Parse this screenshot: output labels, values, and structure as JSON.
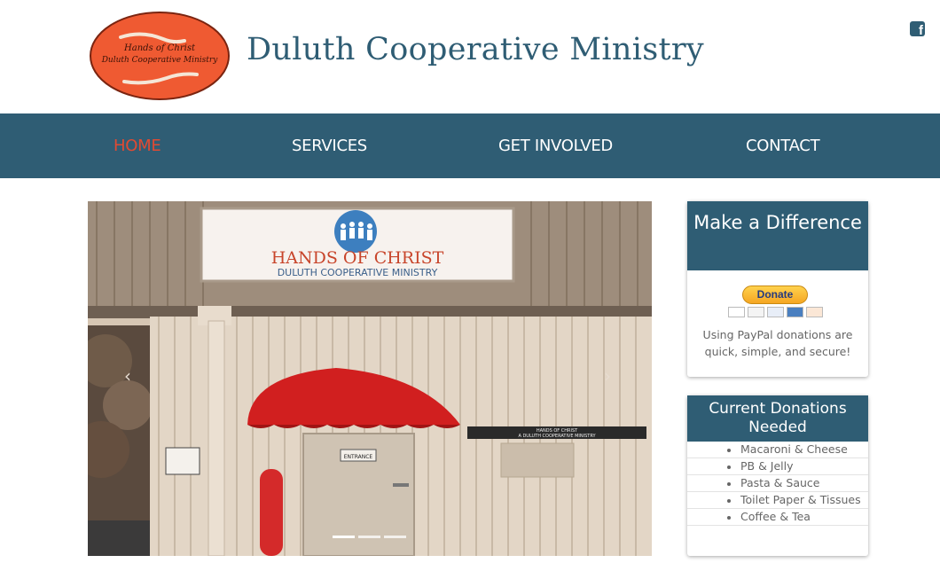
{
  "header": {
    "site_title": "Duluth Cooperative Ministry",
    "logo": {
      "line1": "Hands of Christ",
      "line2": "Duluth Cooperative Ministry"
    },
    "facebook_icon": "facebook-icon"
  },
  "nav": {
    "items": [
      {
        "label": "HOME",
        "active": true
      },
      {
        "label": "SERVICES",
        "active": false
      },
      {
        "label": "GET INVOLVED",
        "active": false
      },
      {
        "label": "CONTACT",
        "active": false
      }
    ]
  },
  "slider": {
    "sign_title": "HANDS OF CHRIST",
    "sign_subtitle": "DULUTH COOPERATIVE MINISTRY",
    "small_sign_line1": "HANDS OF CHRIST",
    "small_sign_line2": "A DULUTH COOPERATIVE MINISTRY",
    "door_sign": "ENTRANCE",
    "prev_icon": "chevron-left-icon",
    "next_icon": "chevron-right-icon",
    "prev_glyph": "‹",
    "next_glyph": "›",
    "slide_count": 3,
    "active_slide": 1
  },
  "donate_panel": {
    "title": "Make a Difference",
    "button_label": "Donate",
    "text": "Using PayPal donations are quick, simple, and secure!"
  },
  "donations_panel": {
    "title": "Current Donations Needed",
    "items": [
      "Macaroni & Cheese",
      "PB & Jelly",
      "Pasta & Sauce",
      "Toilet Paper & Tissues",
      "Coffee & Tea"
    ]
  },
  "colors": {
    "brand": "#2f5d74",
    "active_nav": "#e14a32",
    "awning": "#d11f1f",
    "logo_fill": "#ef5a32"
  }
}
